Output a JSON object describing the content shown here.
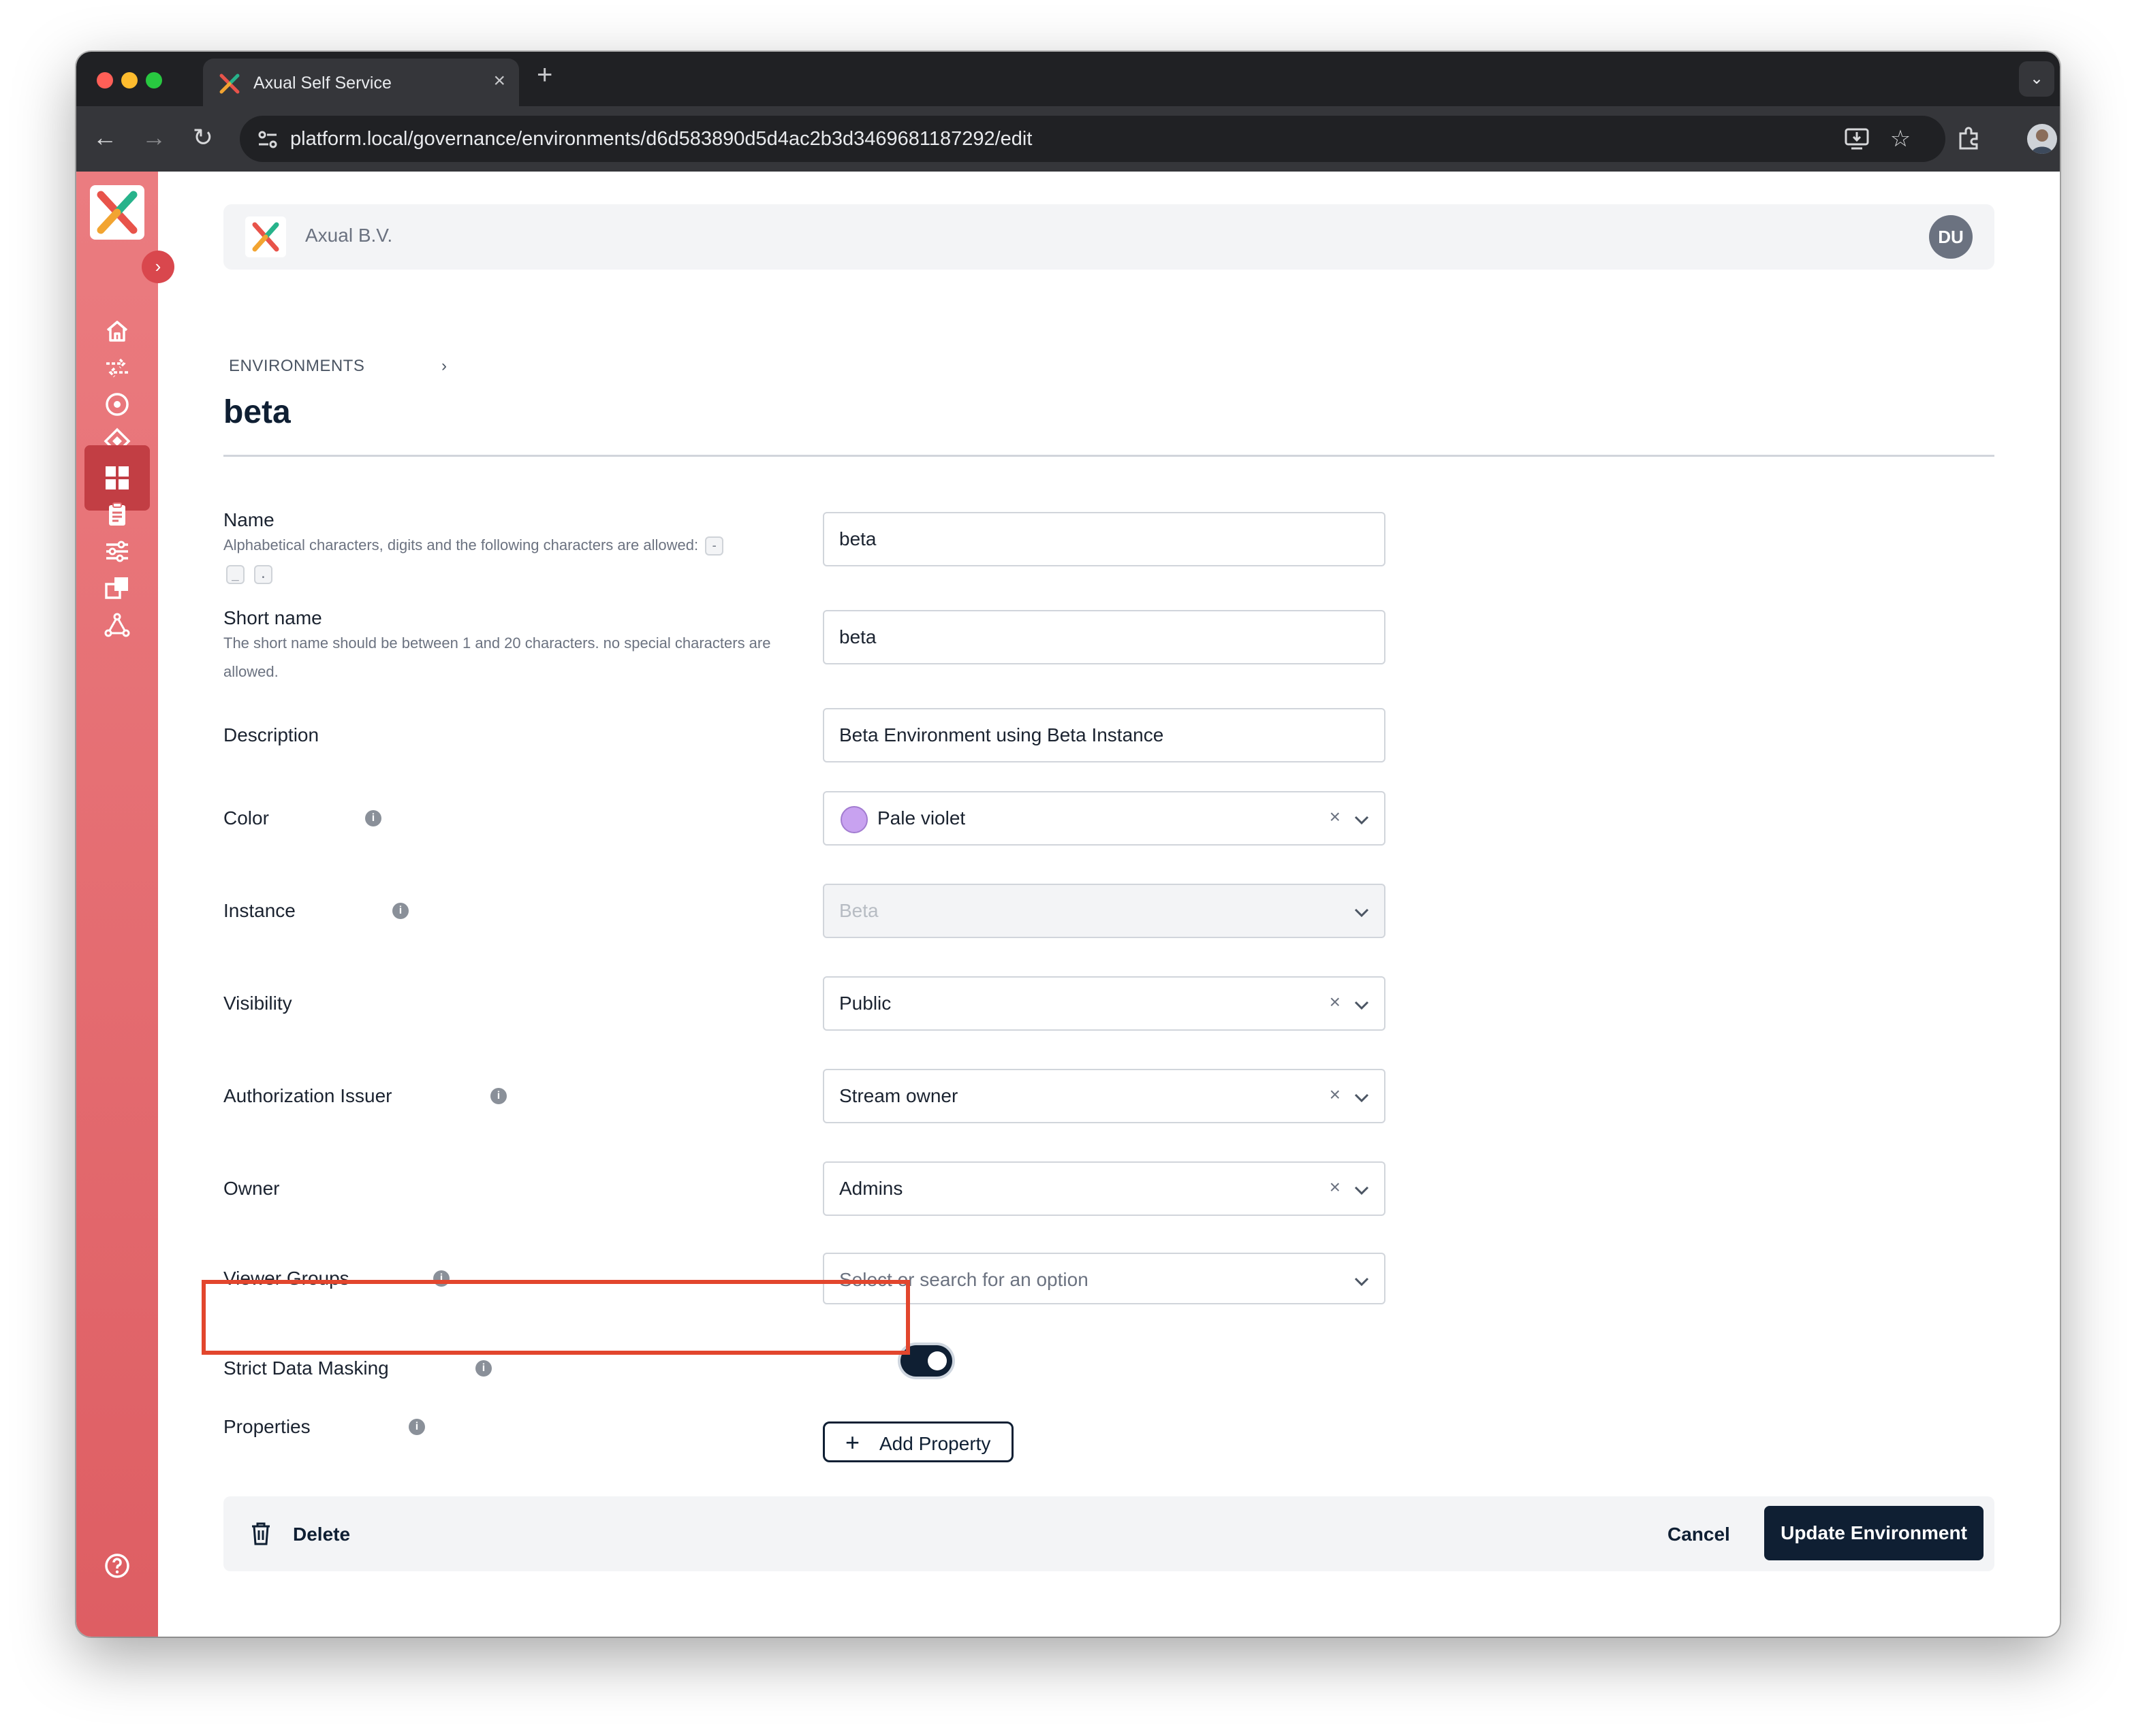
{
  "browser": {
    "tab_title": "Axual Self Service",
    "tab_close": "×",
    "new_tab": "+",
    "url": "platform.local/governance/environments/d6d583890d5d4ac2b3d3469681187292/edit"
  },
  "colors": {
    "sidebar_top": "#eb7c80",
    "sidebar_bottom": "#de5e63",
    "primary": "#0f1f33",
    "highlight": "#e2462d",
    "pale_violet": "#c8a2f0"
  },
  "sidebar": {
    "items": [
      {
        "icon": "home-icon"
      },
      {
        "icon": "streams-icon"
      },
      {
        "icon": "applications-icon"
      },
      {
        "icon": "schemas-icon"
      },
      {
        "icon": "environments-icon",
        "active": true
      },
      {
        "icon": "clipboard-icon"
      },
      {
        "icon": "settings-sliders-icon"
      },
      {
        "icon": "instances-icon"
      },
      {
        "icon": "topology-icon"
      }
    ],
    "help_icon": "help-icon"
  },
  "header": {
    "org_name": "Axual B.V.",
    "avatar_initials": "DU"
  },
  "page": {
    "breadcrumb": "ENVIRONMENTS",
    "title": "beta"
  },
  "form": {
    "name": {
      "label": "Name",
      "hint": "Alphabetical characters, digits and the following characters are allowed:",
      "allowed_chars": [
        "-",
        "_",
        "."
      ],
      "value": "beta"
    },
    "short_name": {
      "label": "Short name",
      "hint": "The short name should be between 1 and 20 characters. no special characters are allowed.",
      "value": "beta"
    },
    "description": {
      "label": "Description",
      "value": "Beta Environment using Beta Instance"
    },
    "color": {
      "label": "Color",
      "value": "Pale violet"
    },
    "instance": {
      "label": "Instance",
      "value": "Beta",
      "disabled": true
    },
    "visibility": {
      "label": "Visibility",
      "value": "Public"
    },
    "authorization_issuer": {
      "label": "Authorization Issuer",
      "value": "Stream owner"
    },
    "owner": {
      "label": "Owner",
      "value": "Admins"
    },
    "viewer_groups": {
      "label": "Viewer Groups",
      "placeholder": "Select or search for an option"
    },
    "strict_data_masking": {
      "label": "Strict Data Masking",
      "enabled": true
    },
    "properties": {
      "label": "Properties",
      "add_button": "Add Property"
    }
  },
  "footer": {
    "delete_label": "Delete",
    "cancel_label": "Cancel",
    "update_label": "Update Environment"
  }
}
